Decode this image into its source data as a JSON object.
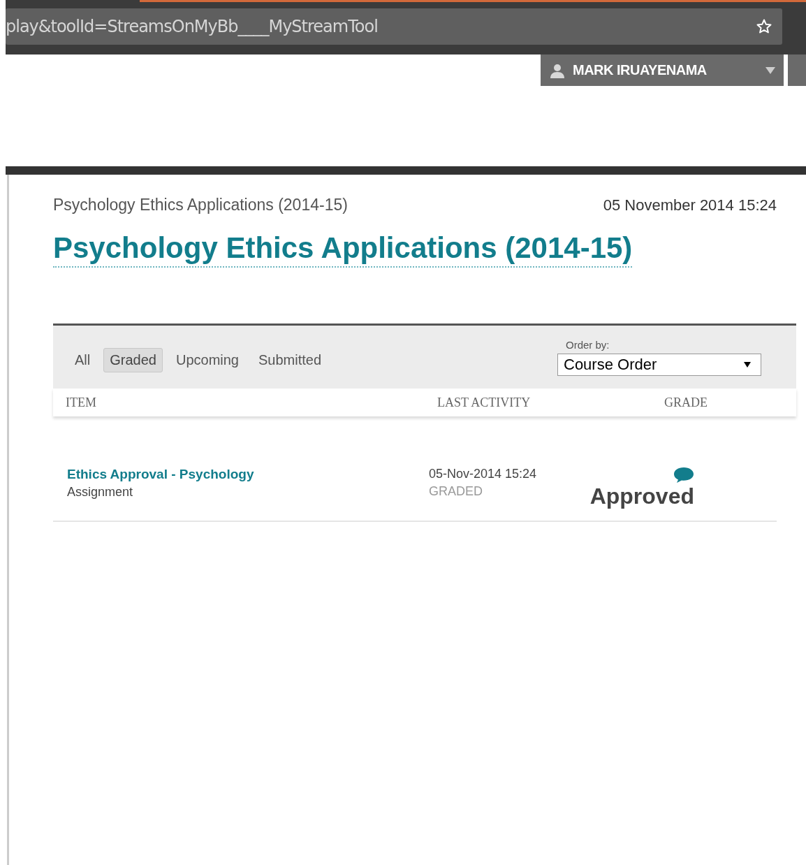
{
  "browser": {
    "address": "play&toolId=StreamsOnMyBb____MyStreamTool"
  },
  "user_menu": {
    "name": "MARK IRUAYENAMA"
  },
  "header": {
    "breadcrumb": "Psychology Ethics Applications (2014-15)",
    "date": "05 November 2014 15:24",
    "title": "Psychology Ethics Applications (2014-15)"
  },
  "filters": [
    {
      "label": "All",
      "selected": false
    },
    {
      "label": "Graded",
      "selected": true
    },
    {
      "label": "Upcoming",
      "selected": false
    },
    {
      "label": "Submitted",
      "selected": false
    }
  ],
  "order_by": {
    "label": "Order by:",
    "value": "Course Order"
  },
  "table": {
    "columns": [
      "ITEM",
      "LAST ACTIVITY",
      "GRADE"
    ],
    "rows": [
      {
        "item": "Ethics Approval - Psychology",
        "type": "Assignment",
        "activity": "05-Nov-2014 15:24",
        "status": "GRADED",
        "grade": "Approved",
        "has_comment": true
      }
    ]
  }
}
